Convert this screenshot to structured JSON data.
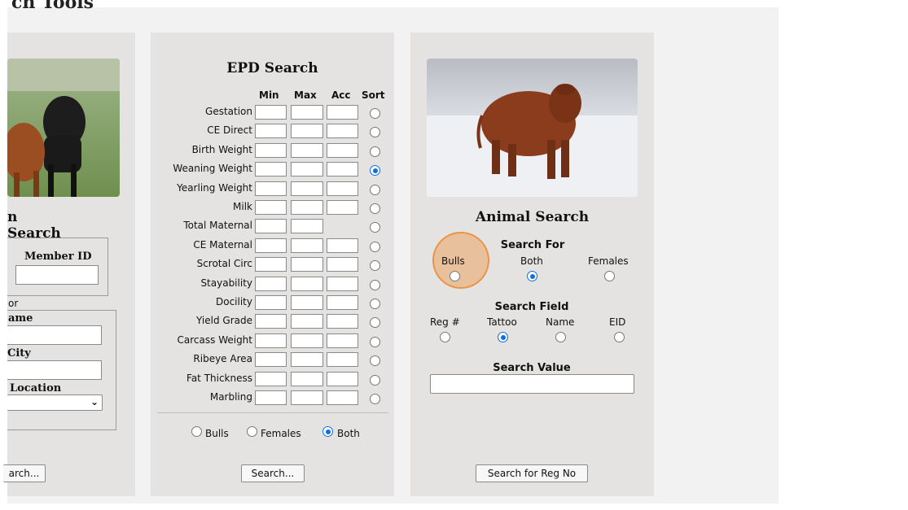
{
  "header": {
    "partial_title": "ch Tools"
  },
  "member_panel": {
    "title": "n Search",
    "member_id_label": "Member ID",
    "or_label": "or",
    "name_label": "ame",
    "city_label": "City",
    "location_label": "Location",
    "search_button": "arch..."
  },
  "epd_panel": {
    "title": "EPD Search",
    "columns": [
      "Min",
      "Max",
      "Acc",
      "Sort"
    ],
    "traits": [
      {
        "label": "Gestation"
      },
      {
        "label": "CE Direct"
      },
      {
        "label": "Birth Weight"
      },
      {
        "label": "Weaning Weight"
      },
      {
        "label": "Yearling Weight"
      },
      {
        "label": "Milk"
      },
      {
        "label": "Total Maternal"
      },
      {
        "label": "CE Maternal"
      },
      {
        "label": "Scrotal Circ"
      },
      {
        "label": "Stayability"
      },
      {
        "label": "Docility"
      },
      {
        "label": "Yield Grade"
      },
      {
        "label": "Carcass Weight"
      },
      {
        "label": "Ribeye Area"
      },
      {
        "label": "Fat Thickness"
      },
      {
        "label": "Marbling"
      }
    ],
    "sort_selected": "Weaning Weight",
    "sex_options": [
      "Bulls",
      "Females",
      "Both"
    ],
    "sex_selected": "Both",
    "search_button": "Search..."
  },
  "animal_panel": {
    "title": "Animal Search",
    "search_for_label": "Search For",
    "search_for_options": [
      "Bulls",
      "Both",
      "Females"
    ],
    "search_for_selected": "Both",
    "search_field_label": "Search Field",
    "search_field_options": [
      "Reg #",
      "Tattoo",
      "Name",
      "EID"
    ],
    "search_field_selected": "Tattoo",
    "search_value_label": "Search Value",
    "search_value": "",
    "search_button": "Search for Reg No"
  },
  "colors": {
    "panel_bg": "#e4e3e2",
    "radio_selected": "#0f6fde",
    "highlight": "#ee9646"
  }
}
